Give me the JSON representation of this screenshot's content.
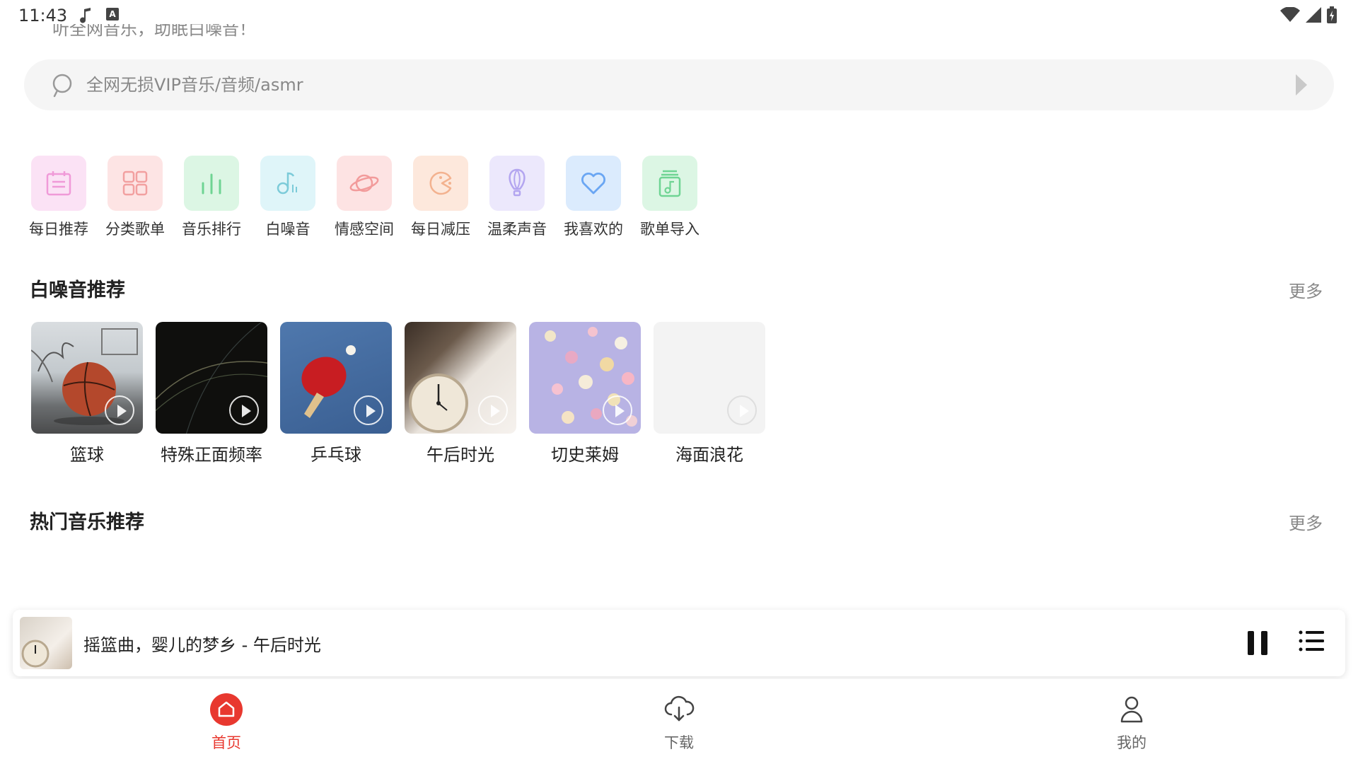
{
  "status_bar": {
    "time": "11:43"
  },
  "top_hint": "听全网音乐，助眠白噪音！",
  "search": {
    "placeholder": "全网无损VIP音乐/音频/asmr"
  },
  "shortcuts": [
    {
      "label": "每日推荐",
      "icon": "calendar-icon",
      "bg": "#fbe2f5",
      "color": "#f09ad8"
    },
    {
      "label": "分类歌单",
      "icon": "grid-icon",
      "bg": "#fde4e4",
      "color": "#f2a0a0"
    },
    {
      "label": "音乐排行",
      "icon": "bars-icon",
      "bg": "#dcf6e4",
      "color": "#6fd493"
    },
    {
      "label": "白噪音",
      "icon": "music-note-icon",
      "bg": "#dff5f9",
      "color": "#7ccbd9"
    },
    {
      "label": "情感空间",
      "icon": "planet-icon",
      "bg": "#fde3e3",
      "color": "#f29b9b"
    },
    {
      "label": "每日减压",
      "icon": "pacman-icon",
      "bg": "#fde8dc",
      "color": "#f3b28f"
    },
    {
      "label": "温柔声音",
      "icon": "balloon-icon",
      "bg": "#ece8fc",
      "color": "#b3a5f0"
    },
    {
      "label": "我喜欢的",
      "icon": "heart-icon",
      "bg": "#dbebfd",
      "color": "#6aa6f3"
    },
    {
      "label": "歌单导入",
      "icon": "music-file-icon",
      "bg": "#dcf6e4",
      "color": "#6fd493"
    }
  ],
  "white_noise": {
    "title": "白噪音推荐",
    "more": "更多",
    "items": [
      {
        "label": "篮球",
        "art": "basketball"
      },
      {
        "label": "特殊正面频率",
        "art": "dark-waves"
      },
      {
        "label": "乒乓球",
        "art": "ping-pong"
      },
      {
        "label": "午后时光",
        "art": "alarm-clock"
      },
      {
        "label": "切史莱姆",
        "art": "marshmallows"
      },
      {
        "label": "海面浪花",
        "art": "blank"
      }
    ]
  },
  "hot_music": {
    "title": "热门音乐推荐",
    "more": "更多"
  },
  "player": {
    "title": "摇篮曲，婴儿的梦乡 - 午后时光"
  },
  "nav": [
    {
      "label": "首页",
      "icon": "home-icon",
      "active": true
    },
    {
      "label": "下载",
      "icon": "cloud-download-icon",
      "active": false
    },
    {
      "label": "我的",
      "icon": "user-icon",
      "active": false
    }
  ],
  "colors": {
    "accent": "#e8382f"
  }
}
